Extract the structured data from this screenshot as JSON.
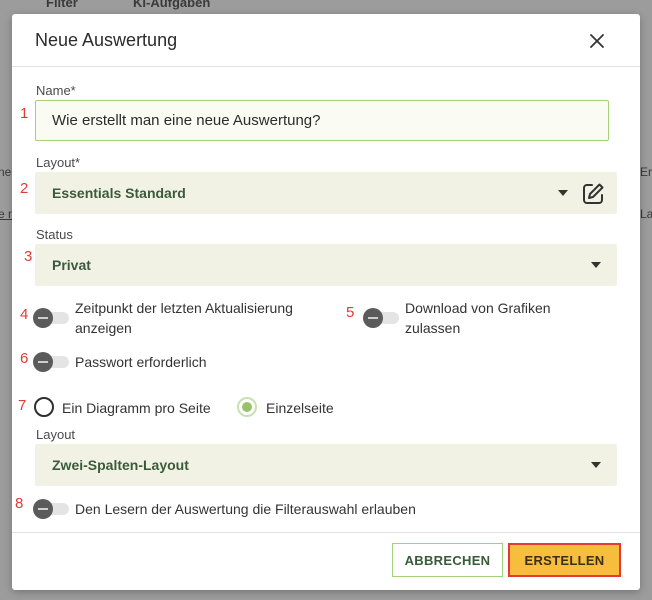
{
  "background": {
    "tabs": [
      "Filter",
      "KI-Aufgaben"
    ],
    "edge_fragments": [
      "ne",
      "e n",
      "Ers",
      "La"
    ]
  },
  "dialog": {
    "title": "Neue Auswertung",
    "close_icon": "close-icon",
    "fields": {
      "name": {
        "label": "Name*",
        "value": "Wie erstellt man eine neue Auswertung?",
        "marker": "1"
      },
      "layout": {
        "label": "Layout*",
        "value": "Essentials Standard",
        "marker": "2",
        "edit_icon": "edit-icon"
      },
      "status": {
        "label": "Status",
        "value": "Privat",
        "marker": "3"
      },
      "toggle_last_update": {
        "label_line1": "Zeitpunkt der letzten Aktualisierung",
        "label_line2": "anzeigen",
        "marker": "4",
        "checked": false
      },
      "toggle_download": {
        "label_line1": "Download von Grafiken",
        "label_line2": "zulassen",
        "marker": "5",
        "checked": false
      },
      "toggle_password": {
        "label": "Passwort erforderlich",
        "marker": "6",
        "checked": false
      },
      "page_mode": {
        "marker": "7",
        "options": [
          "Ein Diagramm pro Seite",
          "Einzelseite"
        ],
        "selected": "Einzelseite"
      },
      "page_layout": {
        "label": "Layout",
        "value": "Zwei-Spalten-Layout"
      },
      "toggle_filter": {
        "label": "Den Lesern der Auswertung die Filterauswahl erlauben",
        "marker": "8",
        "checked": false
      }
    },
    "buttons": {
      "cancel": "ABBRECHEN",
      "create": "ERSTELLEN"
    }
  },
  "colors": {
    "accent_green": "#a6d07b",
    "radio_selected": "#97c26b",
    "select_bg": "#f2f2e4",
    "primary_button": "#f6be3c",
    "highlight_border": "#e53935",
    "marker_color": "#e53935"
  }
}
